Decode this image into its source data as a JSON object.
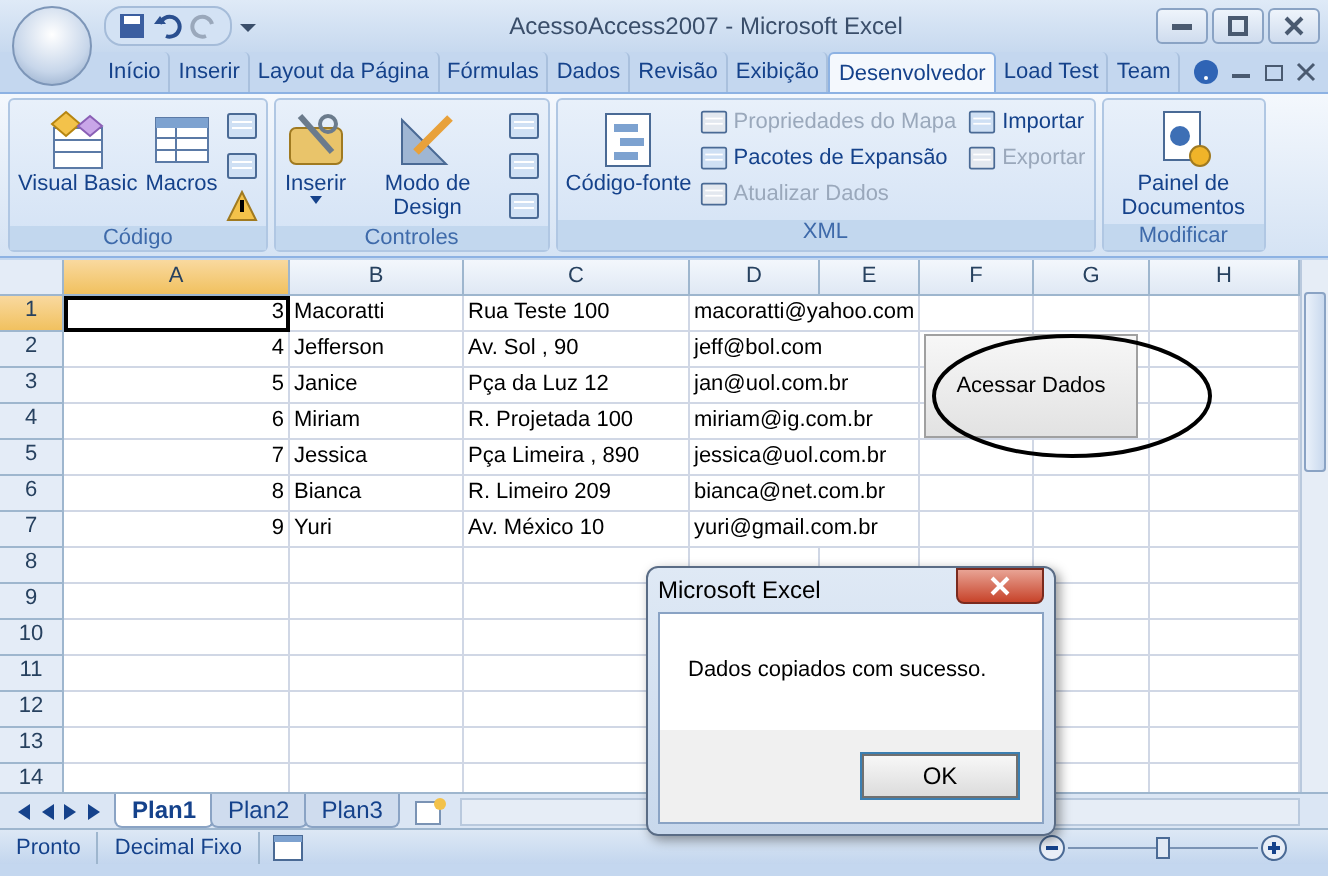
{
  "window": {
    "title": "AcessoAccess2007 - Microsoft Excel"
  },
  "tabs": [
    {
      "label": "Início",
      "selected": false
    },
    {
      "label": "Inserir",
      "selected": false
    },
    {
      "label": "Layout da Página",
      "selected": false
    },
    {
      "label": "Fórmulas",
      "selected": false
    },
    {
      "label": "Dados",
      "selected": false
    },
    {
      "label": "Revisão",
      "selected": false
    },
    {
      "label": "Exibição",
      "selected": false
    },
    {
      "label": "Desenvolvedor",
      "selected": true
    },
    {
      "label": "Load Test",
      "selected": false
    },
    {
      "label": "Team",
      "selected": false
    }
  ],
  "ribbon": [
    {
      "name": "Código",
      "large": [
        {
          "label": "Visual Basic",
          "dropdown": false
        },
        {
          "label": "Macros",
          "dropdown": false
        }
      ]
    },
    {
      "name": "Controles",
      "large": [
        {
          "label": "Inserir",
          "dropdown": true
        },
        {
          "label": "Modo de Design",
          "dropdown": false
        }
      ]
    },
    {
      "name": "XML",
      "large": [
        {
          "label": "Código-fonte",
          "dropdown": false
        }
      ],
      "small": [
        {
          "label": "Propriedades do Mapa",
          "disabled": true
        },
        {
          "label": "Pacotes de Expansão",
          "disabled": false
        },
        {
          "label": "Atualizar Dados",
          "disabled": true
        },
        {
          "label": "Importar",
          "disabled": false
        },
        {
          "label": "Exportar",
          "disabled": true
        }
      ]
    },
    {
      "name": "Modificar",
      "large": [
        {
          "label": "Painel de Documentos",
          "dropdown": false
        }
      ]
    }
  ],
  "columns": [
    {
      "label": "A",
      "selected": true
    },
    {
      "label": "B",
      "selected": false
    },
    {
      "label": "C",
      "selected": false
    },
    {
      "label": "D",
      "selected": false
    },
    {
      "label": "E",
      "selected": false
    },
    {
      "label": "F",
      "selected": false
    },
    {
      "label": "G",
      "selected": false
    },
    {
      "label": "H",
      "selected": false
    }
  ],
  "rows": [
    {
      "header": "1",
      "selected": true,
      "cells": [
        "3",
        "Macoratti",
        "Rua Teste 100",
        "macoratti@yahoo.com"
      ]
    },
    {
      "header": "2",
      "selected": false,
      "cells": [
        "4",
        "Jefferson",
        "Av. Sol , 90",
        "jeff@bol.com"
      ]
    },
    {
      "header": "3",
      "selected": false,
      "cells": [
        "5",
        "Janice",
        "Pça da Luz 12",
        "jan@uol.com.br"
      ]
    },
    {
      "header": "4",
      "selected": false,
      "cells": [
        "6",
        "Miriam",
        "R. Projetada 100",
        "miriam@ig.com.br"
      ]
    },
    {
      "header": "5",
      "selected": false,
      "cells": [
        "7",
        "Jessica",
        "Pça Limeira , 890",
        "jessica@uol.com.br"
      ]
    },
    {
      "header": "6",
      "selected": false,
      "cells": [
        "8",
        "Bianca",
        "R. Limeiro  209",
        "bianca@net.com.br"
      ]
    },
    {
      "header": "7",
      "selected": false,
      "cells": [
        "9",
        "Yuri",
        "Av. México 10",
        "yuri@gmail.com.br"
      ]
    },
    {
      "header": "8",
      "selected": false,
      "cells": []
    },
    {
      "header": "9",
      "selected": false,
      "cells": []
    },
    {
      "header": "10",
      "selected": false,
      "cells": []
    },
    {
      "header": "11",
      "selected": false,
      "cells": []
    },
    {
      "header": "12",
      "selected": false,
      "cells": []
    },
    {
      "header": "13",
      "selected": false,
      "cells": []
    },
    {
      "header": "14",
      "selected": false,
      "cells": []
    }
  ],
  "sheet_button": {
    "label": "Acessar Dados"
  },
  "sheet_tabs": [
    {
      "label": "Plan1",
      "selected": true
    },
    {
      "label": "Plan2",
      "selected": false
    },
    {
      "label": "Plan3",
      "selected": false
    }
  ],
  "status_bar": {
    "items": [
      "Pronto",
      "Decimal Fixo"
    ],
    "zoom": {
      "level": 0.5
    }
  },
  "dialog": {
    "title": "Microsoft Excel",
    "message": "Dados copiados com sucesso.",
    "button": "OK"
  }
}
